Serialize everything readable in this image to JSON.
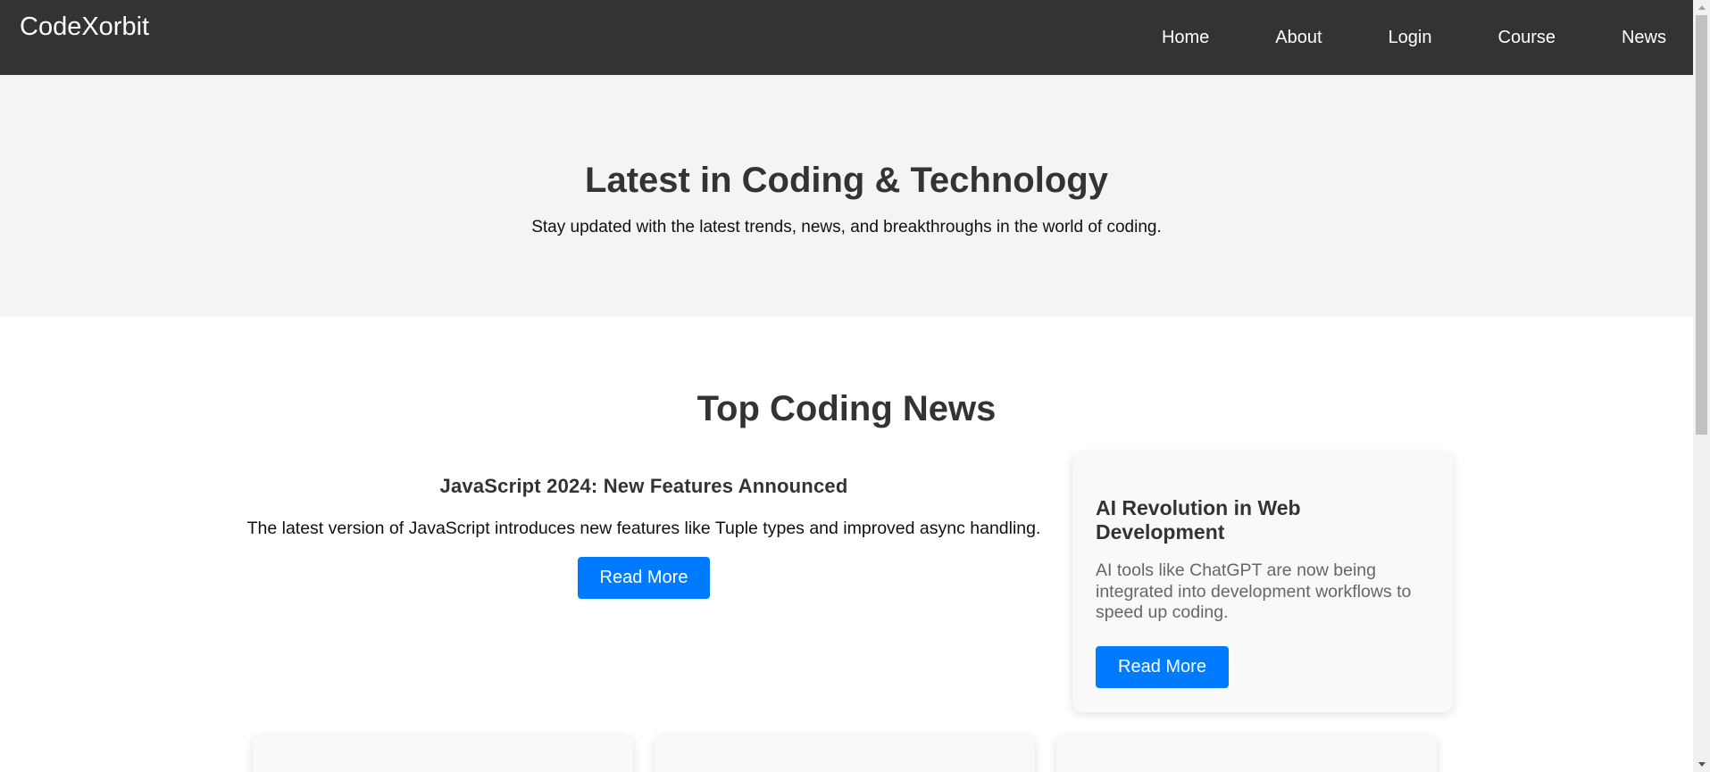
{
  "navbar": {
    "brand": "CodeXorbit",
    "links": [
      "Home",
      "About",
      "Login",
      "Course",
      "News"
    ]
  },
  "hero": {
    "title": "Latest in Coding & Technology",
    "subtitle": "Stay updated with the latest trends, news, and breakthroughs in the world of coding."
  },
  "news": {
    "section_title": "Top Coding News",
    "featured": {
      "title": "JavaScript 2024: New Features Announced",
      "description": "The latest version of JavaScript introduces new features like Tuple types and improved async handling.",
      "button": "Read More"
    },
    "card": {
      "title": "AI Revolution in Web Development",
      "description": "AI tools like ChatGPT are now being integrated into development workflows to speed up coding.",
      "button": "Read More"
    }
  },
  "colors": {
    "navbar_bg": "#333333",
    "hero_bg": "#f4f4f4",
    "accent": "#007bff",
    "card_bg": "#f9f9f9"
  }
}
